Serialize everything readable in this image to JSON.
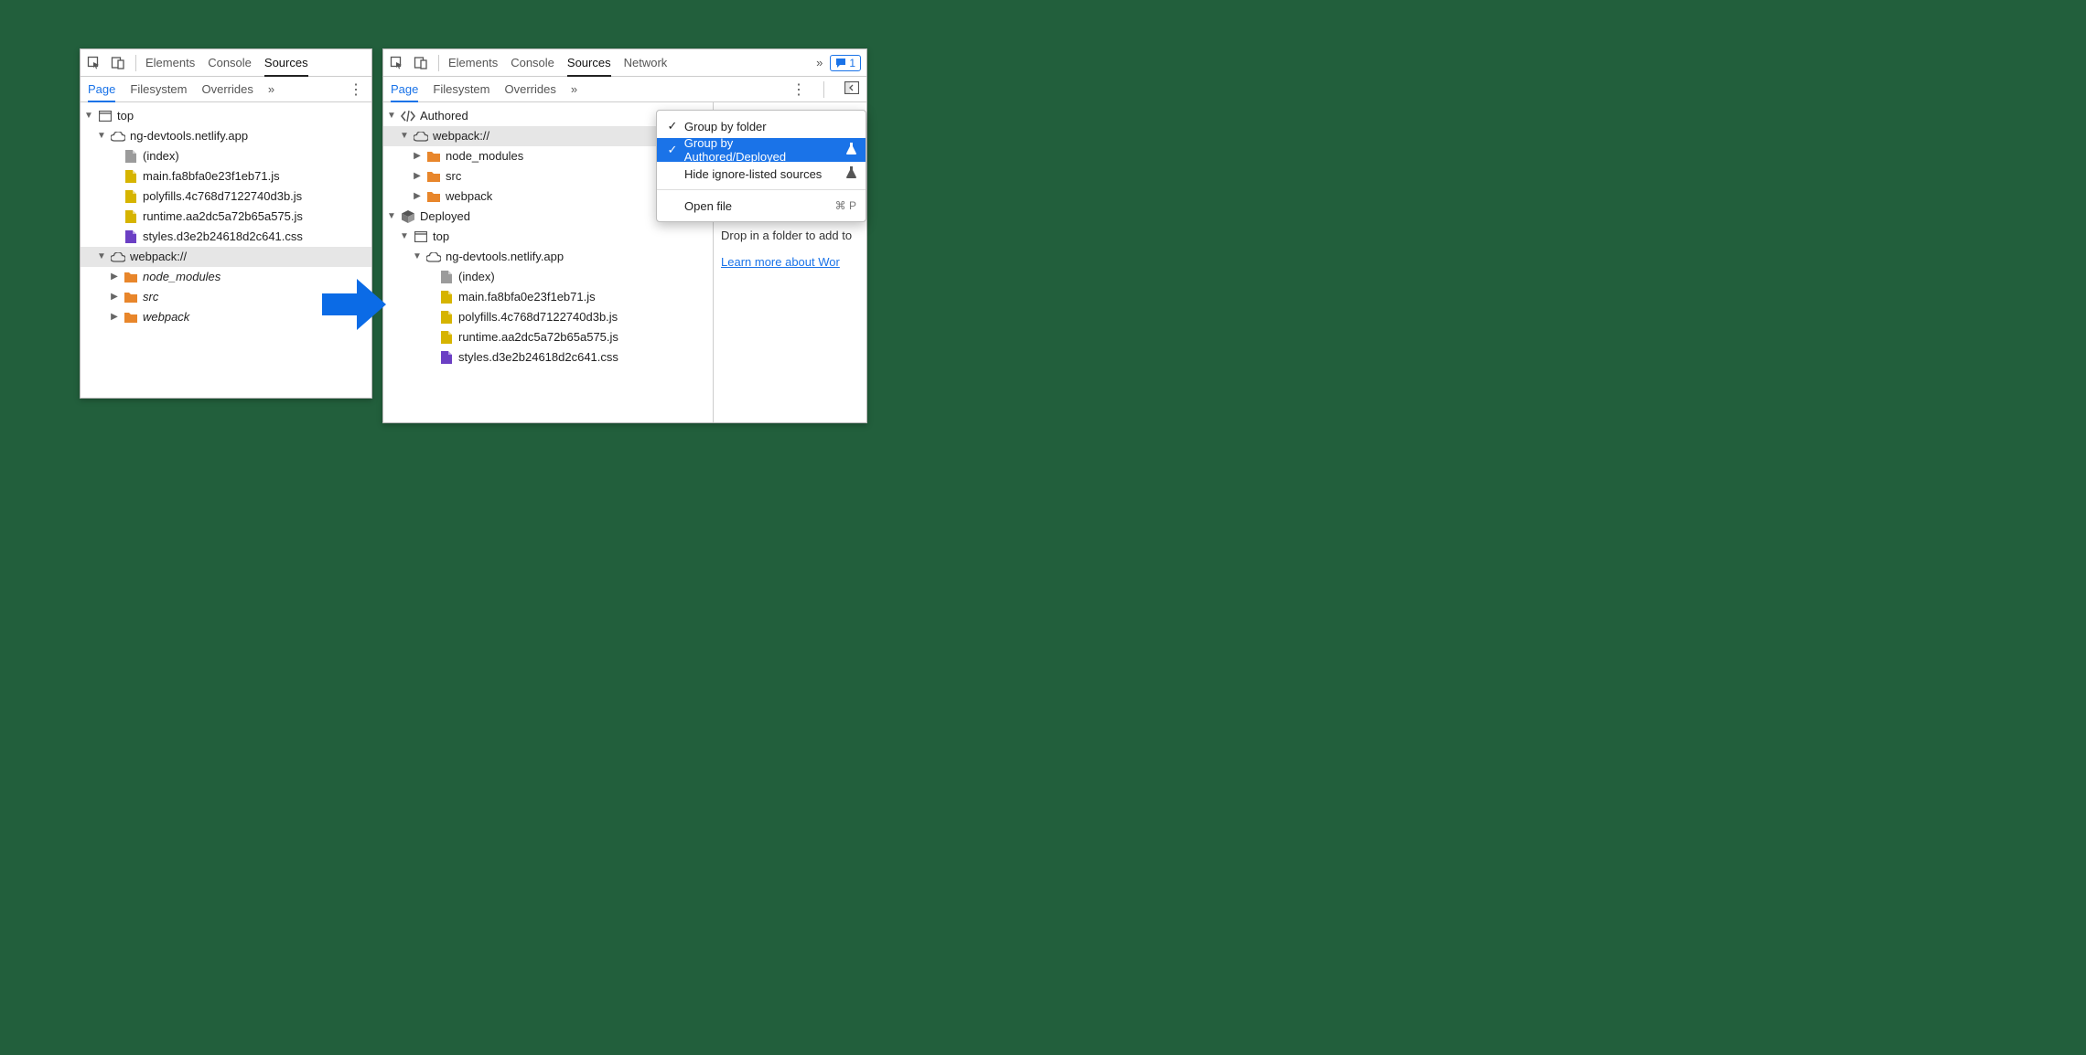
{
  "left": {
    "tabs": [
      "Elements",
      "Console",
      "Sources"
    ],
    "active_tab": 2,
    "subtabs": [
      "Page",
      "Filesystem",
      "Overrides"
    ],
    "active_subtab": 0,
    "tree": [
      {
        "indent": 0,
        "arrow": "down",
        "icon": "frame",
        "label": "top"
      },
      {
        "indent": 1,
        "arrow": "down",
        "icon": "cloud",
        "label": "ng-devtools.netlify.app"
      },
      {
        "indent": 2,
        "arrow": "none",
        "icon": "doc-grey",
        "label": "(index)"
      },
      {
        "indent": 2,
        "arrow": "none",
        "icon": "doc-yellow",
        "label": "main.fa8bfa0e23f1eb71.js"
      },
      {
        "indent": 2,
        "arrow": "none",
        "icon": "doc-yellow",
        "label": "polyfills.4c768d7122740d3b.js"
      },
      {
        "indent": 2,
        "arrow": "none",
        "icon": "doc-yellow",
        "label": "runtime.aa2dc5a72b65a575.js"
      },
      {
        "indent": 2,
        "arrow": "none",
        "icon": "doc-purple",
        "label": "styles.d3e2b24618d2c641.css"
      },
      {
        "indent": 1,
        "arrow": "down",
        "icon": "cloud",
        "label": "webpack://",
        "selected": true
      },
      {
        "indent": 2,
        "arrow": "right",
        "icon": "folder",
        "label": "node_modules",
        "italic": true
      },
      {
        "indent": 2,
        "arrow": "right",
        "icon": "folder",
        "label": "src",
        "italic": true
      },
      {
        "indent": 2,
        "arrow": "right",
        "icon": "folder",
        "label": "webpack",
        "italic": true
      }
    ]
  },
  "right": {
    "tabs": [
      "Elements",
      "Console",
      "Sources",
      "Network"
    ],
    "active_tab": 2,
    "subtabs": [
      "Page",
      "Filesystem",
      "Overrides"
    ],
    "active_subtab": 0,
    "issue_count": "1",
    "tree": [
      {
        "indent": 0,
        "arrow": "down",
        "icon": "code",
        "label": "Authored"
      },
      {
        "indent": 1,
        "arrow": "down",
        "icon": "cloud",
        "label": "webpack://",
        "selected": true
      },
      {
        "indent": 2,
        "arrow": "right",
        "icon": "folder",
        "label": "node_modules"
      },
      {
        "indent": 2,
        "arrow": "right",
        "icon": "folder",
        "label": "src"
      },
      {
        "indent": 2,
        "arrow": "right",
        "icon": "folder",
        "label": "webpack"
      },
      {
        "indent": 0,
        "arrow": "down",
        "icon": "box",
        "label": "Deployed"
      },
      {
        "indent": 1,
        "arrow": "down",
        "icon": "frame",
        "label": "top"
      },
      {
        "indent": 2,
        "arrow": "down",
        "icon": "cloud",
        "label": "ng-devtools.netlify.app"
      },
      {
        "indent": 3,
        "arrow": "none",
        "icon": "doc-grey",
        "label": "(index)"
      },
      {
        "indent": 3,
        "arrow": "none",
        "icon": "doc-yellow",
        "label": "main.fa8bfa0e23f1eb71.js"
      },
      {
        "indent": 3,
        "arrow": "none",
        "icon": "doc-yellow",
        "label": "polyfills.4c768d7122740d3b.js"
      },
      {
        "indent": 3,
        "arrow": "none",
        "icon": "doc-yellow",
        "label": "runtime.aa2dc5a72b65a575.js"
      },
      {
        "indent": 3,
        "arrow": "none",
        "icon": "doc-purple",
        "label": "styles.d3e2b24618d2c641.css"
      }
    ],
    "menu": {
      "items": [
        {
          "checked": true,
          "label": "Group by folder"
        },
        {
          "checked": true,
          "label": "Group by Authored/Deployed",
          "experiment": true,
          "highlight": true
        },
        {
          "checked": false,
          "label": "Hide ignore-listed sources",
          "experiment": true
        }
      ],
      "divider_after": 2,
      "open_file_label": "Open file",
      "open_file_shortcut": "⌘ P"
    },
    "drop_text": "Drop in a folder to add to",
    "link_text": "Learn more about Wor"
  }
}
